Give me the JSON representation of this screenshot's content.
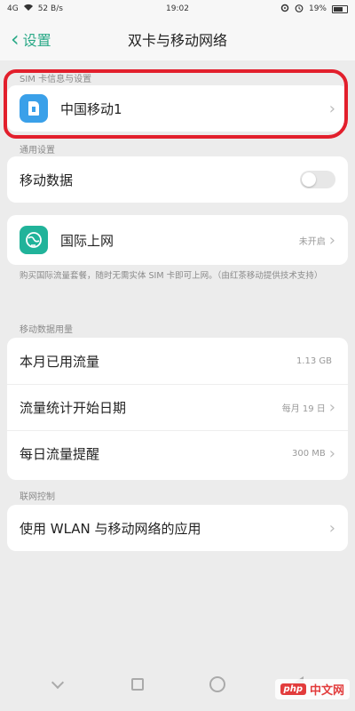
{
  "status_bar": {
    "left_text": "4G",
    "data_rate": "52 B/s",
    "time": "19:02",
    "battery_percent": "19%"
  },
  "header": {
    "back_label": "设置",
    "title": "双卡与移动网络"
  },
  "sections": {
    "sim_info": {
      "label": "SIM 卡信息与设置"
    },
    "general": {
      "label": "通用设置"
    },
    "data_usage": {
      "label": "移动数据用量"
    },
    "network_control": {
      "label": "联网控制"
    }
  },
  "sim_row": {
    "label": "中国移动1"
  },
  "mobile_data_row": {
    "label": "移动数据",
    "enabled": false
  },
  "roaming_row": {
    "label": "国际上网",
    "value": "未开启"
  },
  "roaming_note": "购买国际流量套餐，随时无需实体 SIM 卡即可上网。（由红茶移动提供技术支持）",
  "usage_rows": [
    {
      "label": "本月已用流量",
      "value": "1.13 GB"
    },
    {
      "label": "流量统计开始日期",
      "value": "每月 19 日"
    },
    {
      "label": "每日流量提醒",
      "value": "300 MB"
    }
  ],
  "wlan_row": {
    "label": "使用 WLAN 与移动网络的应用"
  },
  "nav_bar": {
    "items": [
      "down",
      "recent",
      "home",
      "back"
    ]
  },
  "watermark": {
    "badge": "php",
    "text": "中文网"
  },
  "colors": {
    "accent": "#2aa987",
    "annotation": "#e21f2c",
    "sim_icon": "#3aa0e9",
    "globe_icon": "#21b39a"
  }
}
